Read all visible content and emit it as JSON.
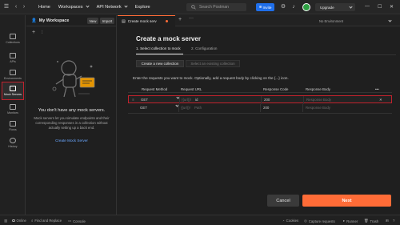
{
  "topbar": {
    "home": "Home",
    "workspaces": "Workspaces",
    "api_network": "API Network",
    "explore": "Explore",
    "search_placeholder": "Search Postman",
    "invite": "Invite",
    "upgrade": "Upgrade"
  },
  "rail": {
    "items": [
      {
        "label": "Collections",
        "icon": "collections-icon"
      },
      {
        "label": "APIs",
        "icon": "apis-icon"
      },
      {
        "label": "Environments",
        "icon": "environments-icon"
      },
      {
        "label": "Mock Servers",
        "icon": "mock-servers-icon"
      },
      {
        "label": "Monitors",
        "icon": "monitors-icon"
      },
      {
        "label": "Flows",
        "icon": "flows-icon"
      },
      {
        "label": "History",
        "icon": "history-icon"
      }
    ]
  },
  "workspace": {
    "title": "My Workspace",
    "new_label": "New",
    "import_label": "Import",
    "empty_title": "You don't have any mock servers.",
    "empty_desc": "Mock servers let you simulate endpoints and their corresponding responses in a collection without actually setting up a back end.",
    "empty_link": "Create Mock Server"
  },
  "tabs": {
    "active_tab": "Create mock serv",
    "environment": "No Environment"
  },
  "main": {
    "title": "Create a mock server",
    "step1": "1. Select collection to mock",
    "step2": "2. Configuration",
    "seg_new": "Create a new collection",
    "seg_existing": "Select an existing collection",
    "instructions": "Enter the requests you want to mock. Optionally, add a request body by clicking on the {...} icon.",
    "headers": {
      "method": "Request Method",
      "url": "Request URL",
      "code": "Response Code",
      "body": "Response Body",
      "more": "•••"
    },
    "rows": [
      {
        "method": "GET",
        "url_prefix": "{{url}}/",
        "url": "id",
        "code": "200",
        "body_placeholder": "Response Body"
      },
      {
        "method": "GET",
        "url_prefix": "{{url}}/",
        "url_placeholder": "Path",
        "code": "200",
        "body_placeholder": "Response Body"
      }
    ],
    "cancel": "Cancel",
    "next": "Next"
  },
  "statusbar": {
    "online": "Online",
    "find_replace": "Find and Replace",
    "console": "Console",
    "cookies": "Cookies",
    "capture": "Capture requests",
    "runner": "Runner",
    "trash": "Trash"
  },
  "colors": {
    "accent": "#ff6c37",
    "invite": "#1f6feb",
    "highlight": "#c2222d"
  }
}
